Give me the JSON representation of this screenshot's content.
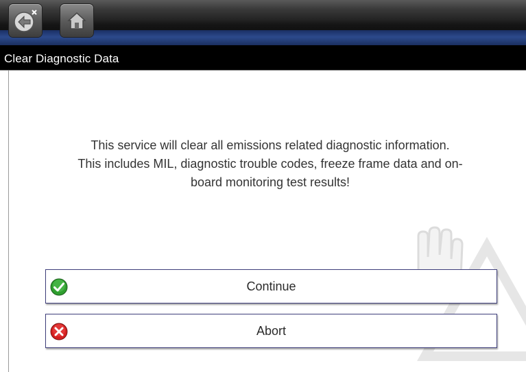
{
  "toolbar": {
    "back_icon": "back-arrow-icon",
    "home_icon": "home-icon"
  },
  "title": "Clear Diagnostic Data",
  "message": {
    "line1": "This service will clear all emissions related diagnostic information.",
    "line2": "This includes MIL, diagnostic trouble codes, freeze frame data and on-",
    "line3": "board monitoring test results!"
  },
  "options": [
    {
      "label": "Continue",
      "icon": "check-icon",
      "color": "#2e9e2e"
    },
    {
      "label": "Abort",
      "icon": "x-icon",
      "color": "#d42020"
    }
  ],
  "colors": {
    "title_bar": "#000000",
    "toolbar_accent": "#2c4a8c",
    "button_border": "#3d3d7a"
  }
}
